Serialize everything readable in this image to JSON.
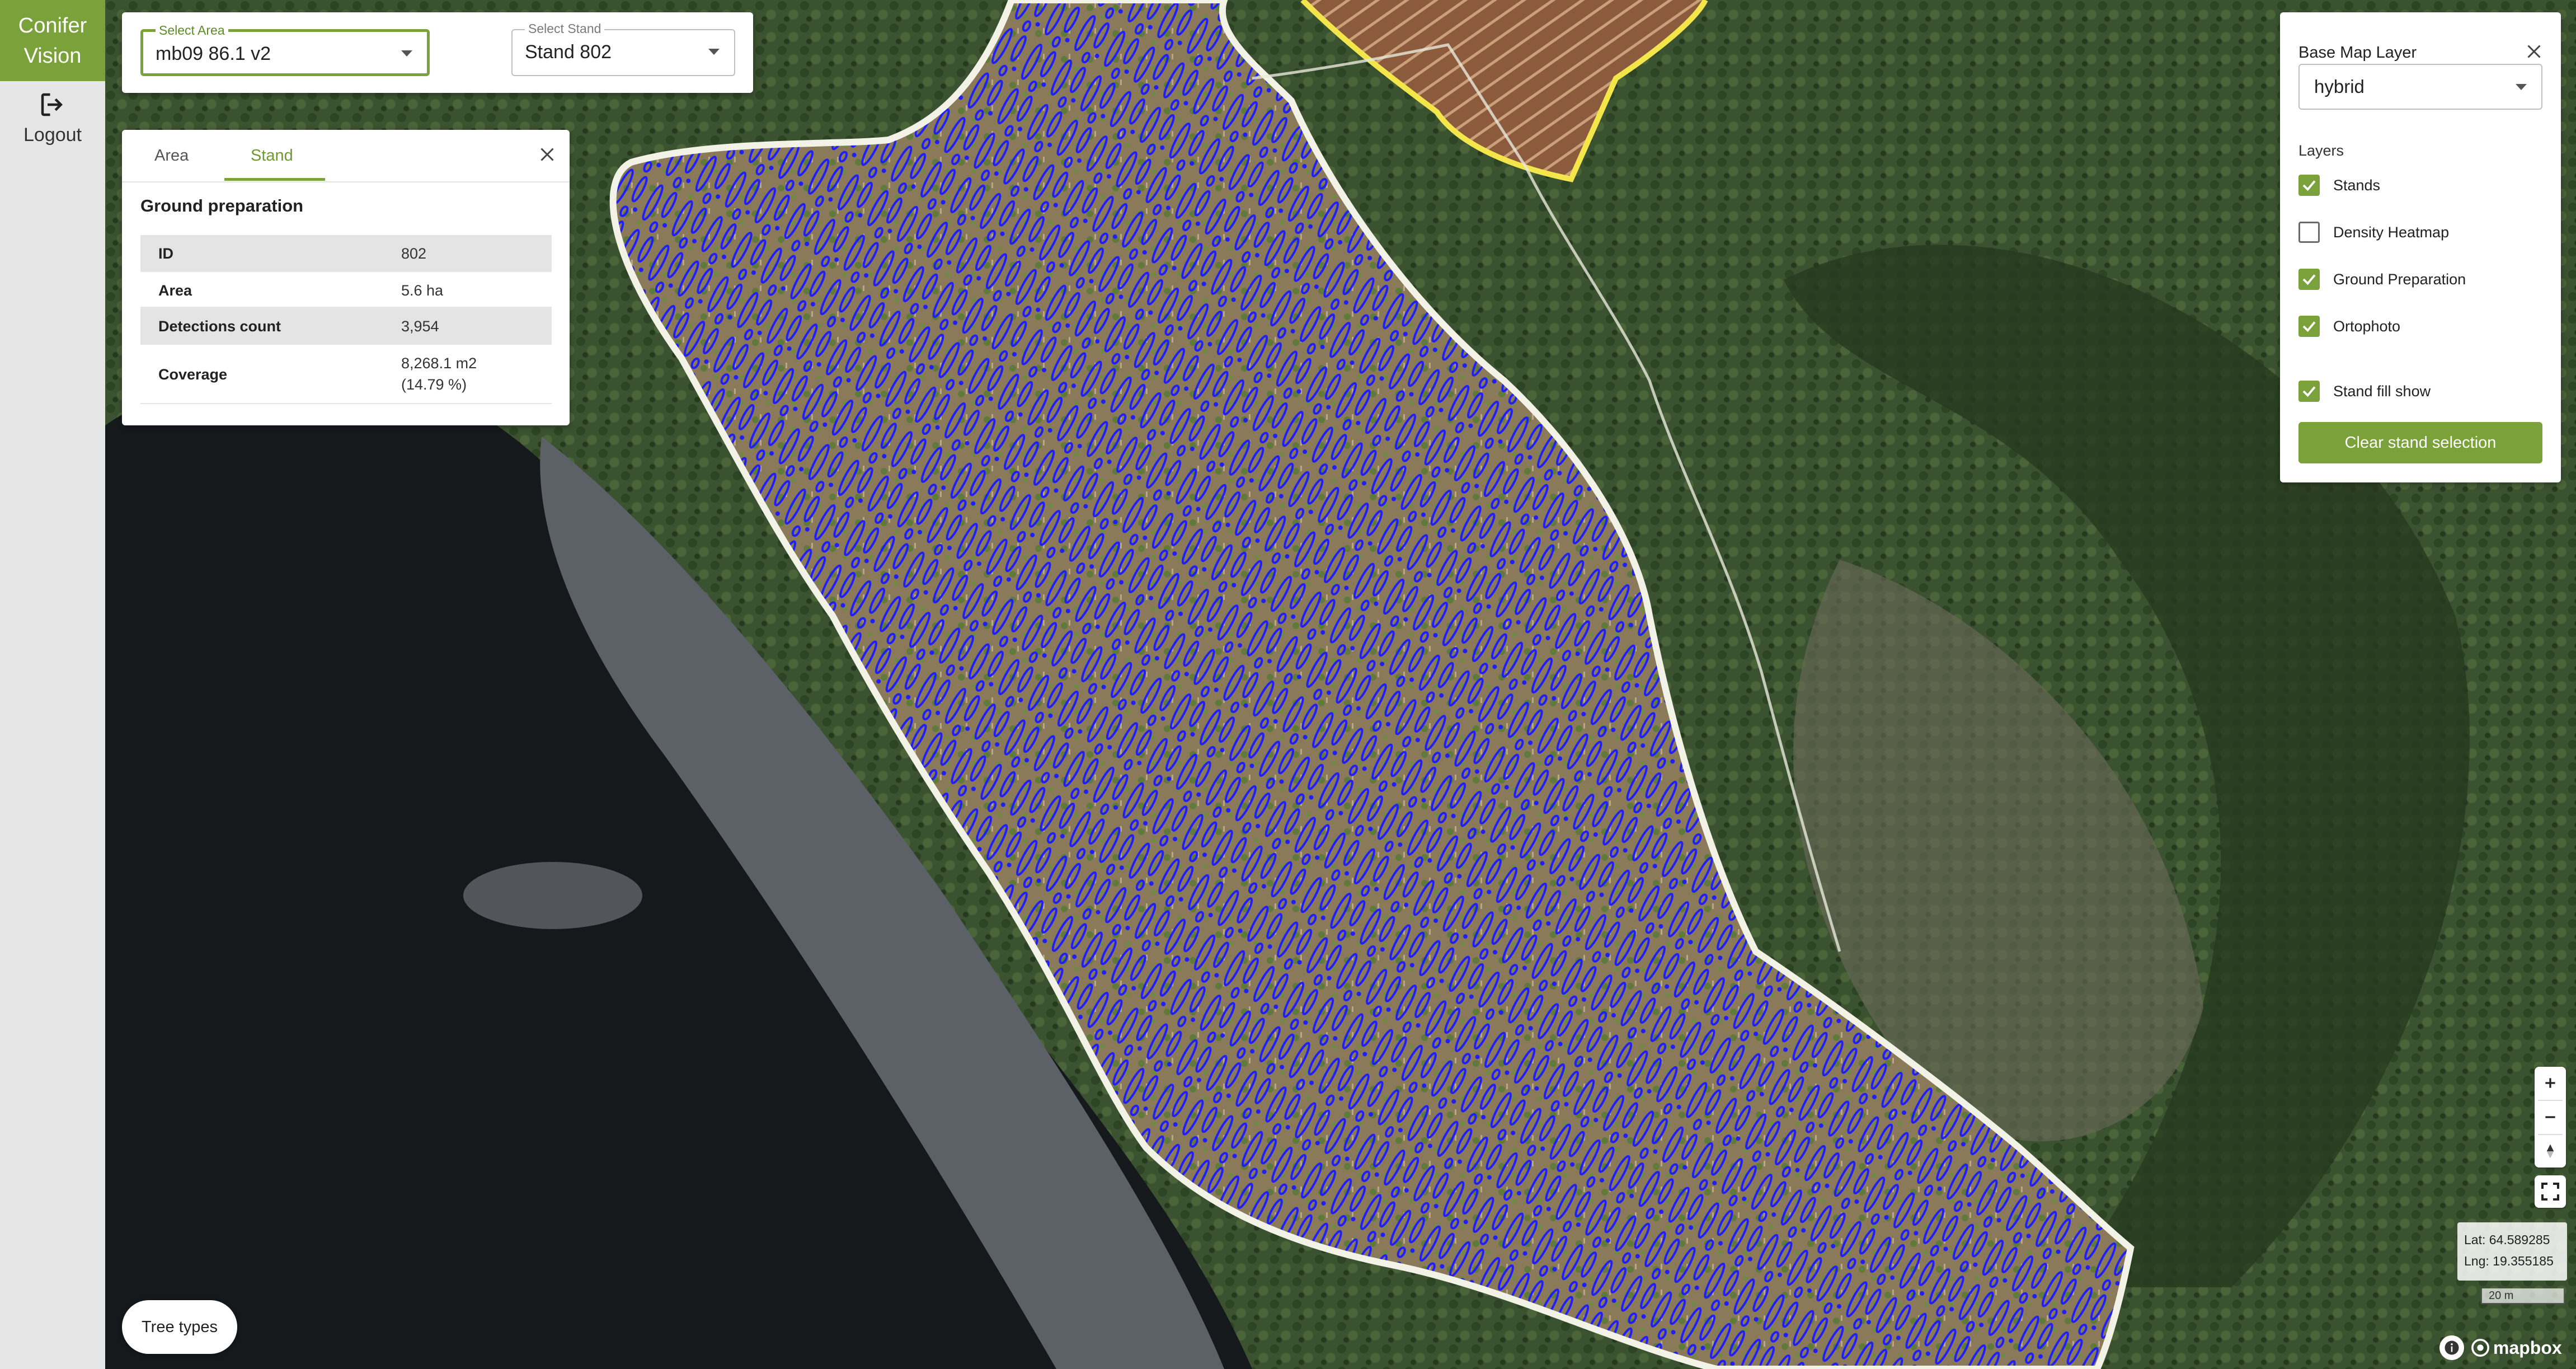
{
  "brand": {
    "line1": "Conifer",
    "line2": "Vision"
  },
  "sidebar": {
    "logout_label": "Logout"
  },
  "selectors": {
    "area": {
      "label": "Select Area",
      "value": "mb09 86.1 v2"
    },
    "stand": {
      "label": "Select Stand",
      "value": "Stand 802"
    }
  },
  "info_panel": {
    "tabs": [
      "Area",
      "Stand"
    ],
    "active_tab": "Stand",
    "section_title": "Ground preparation",
    "rows": [
      {
        "key": "ID",
        "value": "802"
      },
      {
        "key": "Area",
        "value": "5.6 ha"
      },
      {
        "key": "Detections count",
        "value": "3,954"
      },
      {
        "key": "Coverage",
        "value": "8,268.1 m2",
        "value2": "(14.79 %)"
      }
    ]
  },
  "layer_panel": {
    "title": "Base Map Layer",
    "base_map_value": "hybrid",
    "layers_title": "Layers",
    "layers": [
      {
        "label": "Stands",
        "checked": true
      },
      {
        "label": "Density Heatmap",
        "checked": false
      },
      {
        "label": "Ground Preparation",
        "checked": true
      },
      {
        "label": "Ortophoto",
        "checked": true
      },
      {
        "label": "Stand fill show",
        "checked": true
      }
    ],
    "clear_button": "Clear stand selection"
  },
  "tree_types_button": "Tree types",
  "map": {
    "lat": "Lat: 64.589285",
    "lng": "Lng: 19.355185",
    "scale": "20 m",
    "attribution": "mapbox"
  },
  "colors": {
    "accent": "#7aa13a",
    "detections": "#1a1aff",
    "stand_outline": "#f2f2e6",
    "selected_stand_outline": "#f3e64a"
  }
}
